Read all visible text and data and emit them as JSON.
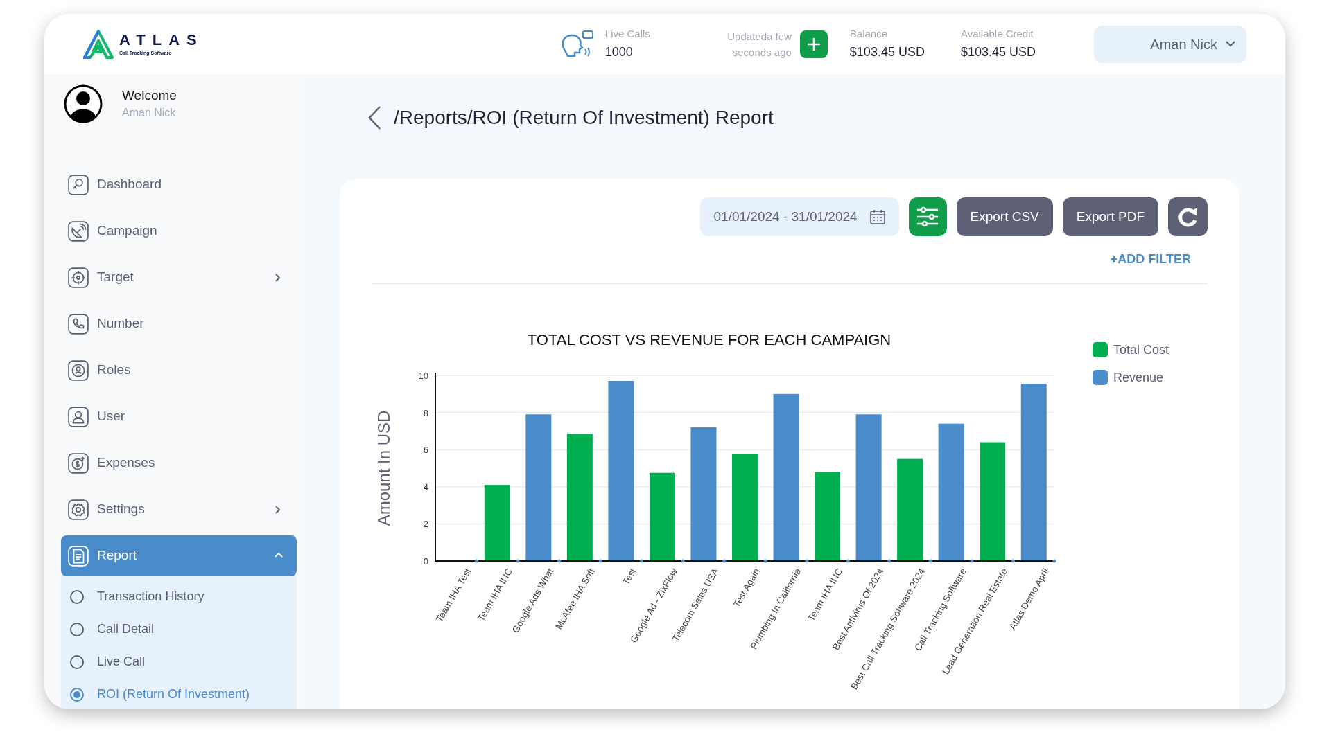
{
  "header": {
    "logo": {
      "name": "ATLAS",
      "tagline": "Call Tracking Software"
    },
    "live_calls": {
      "label": "Live Calls",
      "value": "1000"
    },
    "update_status": "Updateda few seconds ago",
    "balance": {
      "label": "Balance",
      "value": "$103.45 USD"
    },
    "available_credit": {
      "label": "Available Credit",
      "value": "$103.45 USD"
    },
    "user_menu": "Aman Nick"
  },
  "sidebar": {
    "welcome": "Welcome",
    "user_name": "Aman Nick",
    "items": [
      {
        "label": "Dashboard",
        "selected": false
      },
      {
        "label": "Campaign",
        "selected": false
      },
      {
        "label": "Target",
        "selected": false,
        "expanded": false
      },
      {
        "label": "Number",
        "selected": false
      },
      {
        "label": "Roles",
        "selected": false
      },
      {
        "label": "User",
        "selected": false
      },
      {
        "label": "Expenses",
        "selected": false
      },
      {
        "label": "Settings",
        "selected": false,
        "expanded": false
      },
      {
        "label": "Report",
        "selected": true,
        "expanded": true,
        "children": [
          {
            "label": "Transaction History",
            "selected": false
          },
          {
            "label": "Call Detail",
            "selected": false
          },
          {
            "label": "Live Call",
            "selected": false
          },
          {
            "label": "ROI (Return Of Investment)",
            "selected": true
          }
        ]
      }
    ]
  },
  "page": {
    "breadcrumb": "/Reports/ROI (Return Of Investment) Report",
    "date_range": "01/01/2024 - 31/01/2024",
    "buttons": [
      "Export CSV",
      "Export PDF"
    ],
    "add_filter": "+ADD FILTER",
    "chart_data": {
      "type": "bar",
      "title": "TOTAL COST VS REVENUE FOR EACH CAMPAIGN",
      "ylabel": "Amount In USD",
      "grid": true,
      "legend": true,
      "categories": [
        "Team IHA Test",
        "Team IHA INC",
        "Google Ads What",
        "McAfee IHA Soft",
        "Test",
        "Google Ad - ZixFlow",
        "Telecom Sales USA",
        "Test Again",
        "Plumbing In California",
        "Team IHA INC",
        "Best Antivirus Of 2024",
        "Best Call Tracking Software 2024",
        "Call Tracking Software",
        "Lead Generation Real Estate",
        "Atlas Demo April"
      ],
      "series": [
        {
          "name": "Total Cost",
          "color": "#00b050",
          "values": [
            null,
            4.1,
            null,
            6.85,
            null,
            4.75,
            null,
            5.75,
            null,
            4.8,
            null,
            5.5,
            null,
            6.4,
            null
          ]
        },
        {
          "name": "Revenue",
          "color": "#4a8bc9",
          "values": [
            null,
            null,
            7.9,
            null,
            9.7,
            null,
            7.2,
            null,
            9.0,
            null,
            7.9,
            null,
            7.4,
            null,
            9.55
          ]
        }
      ],
      "ylim": [
        0,
        10
      ],
      "yticks": [
        0,
        2,
        4,
        6,
        8,
        10
      ]
    }
  }
}
